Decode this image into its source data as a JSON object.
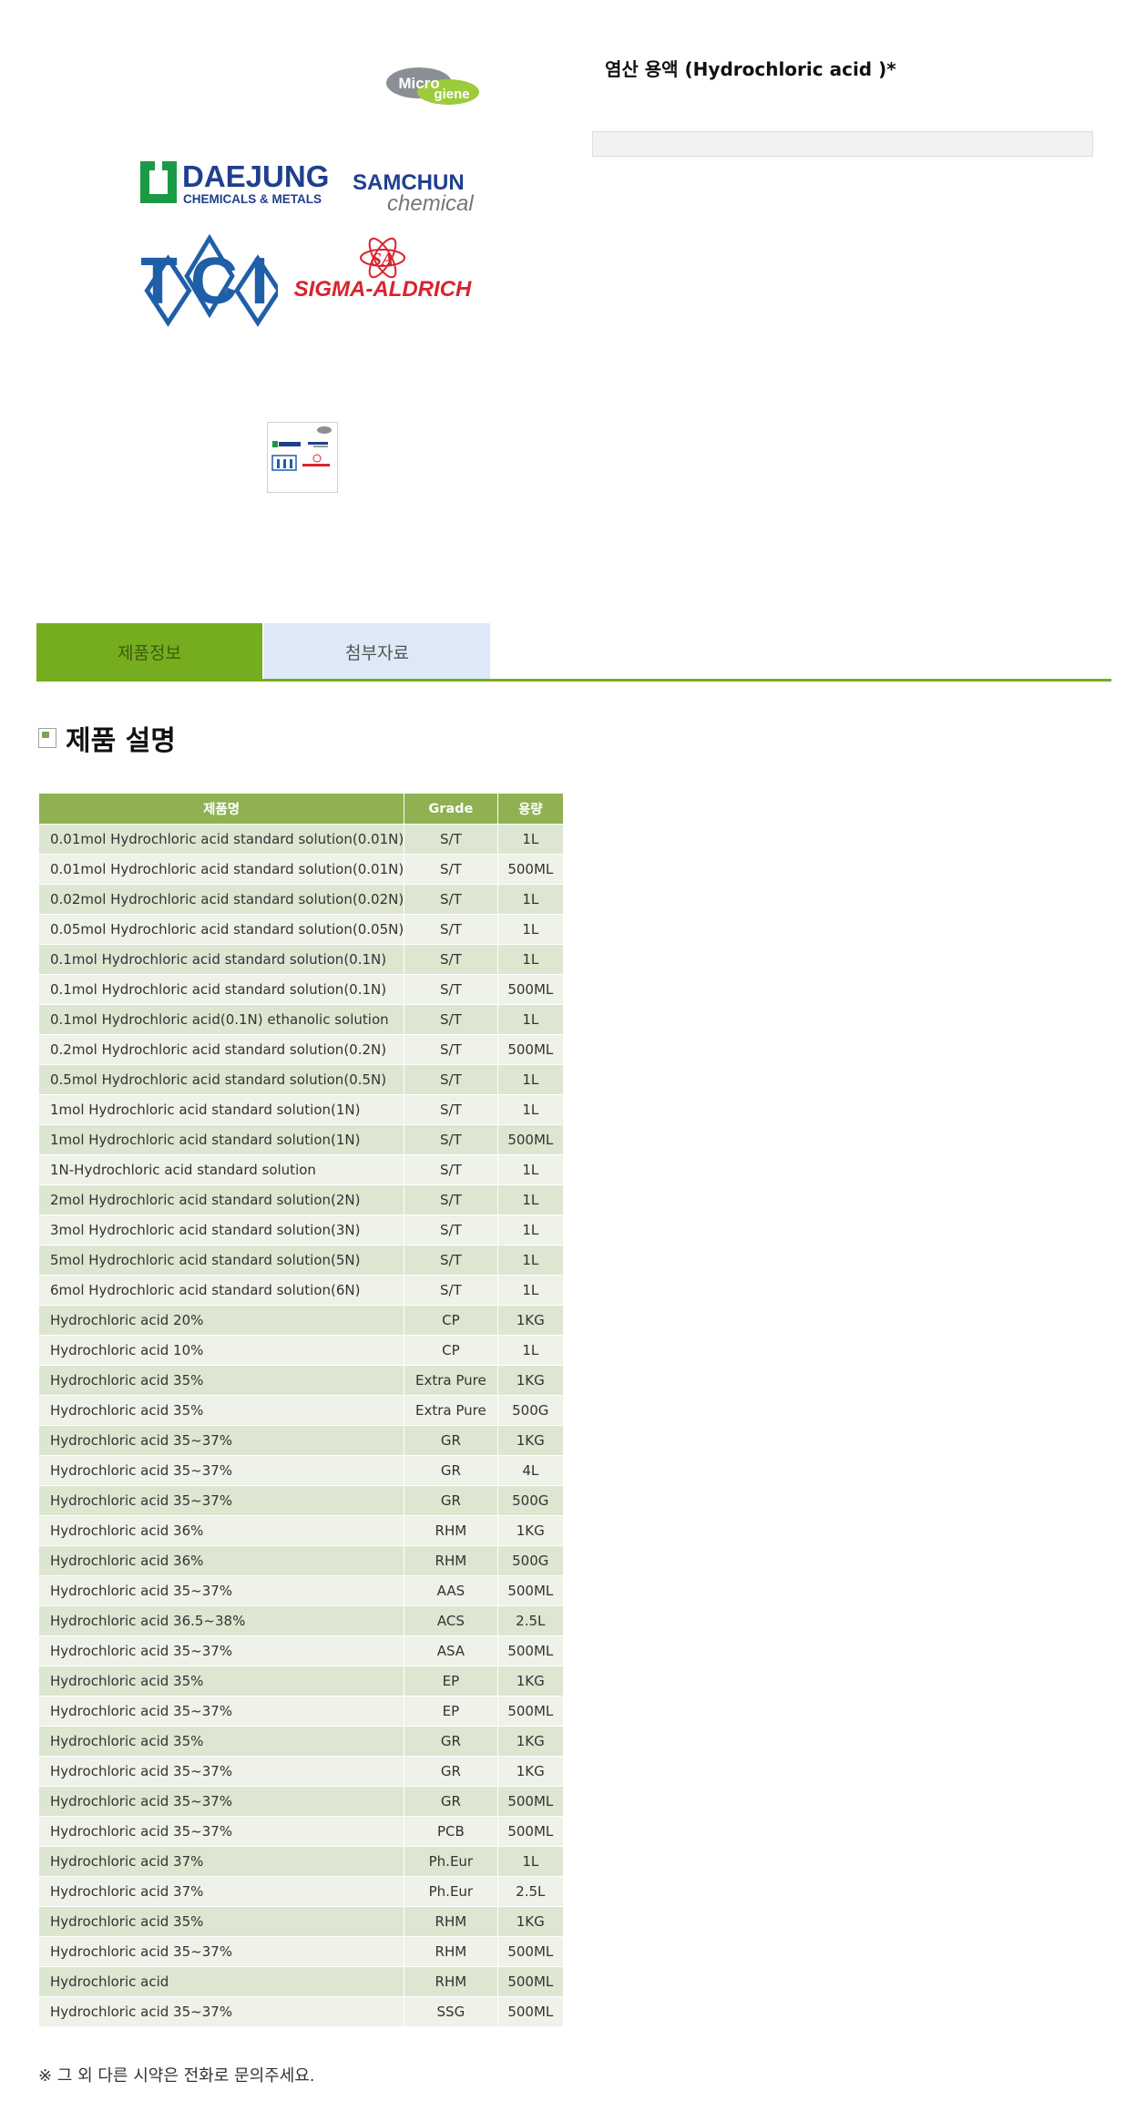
{
  "logos": {
    "microgiene": {
      "line1": "Micro",
      "line2": "giene"
    },
    "daejung": {
      "name": "DAEJUNG",
      "sub": "CHEMICALS & METALS"
    },
    "samchun": {
      "name": "SAMCHUN",
      "sub": "chemical"
    },
    "tci": {
      "name": "TCI"
    },
    "sigma": {
      "name": "SIGMA-ALDRICH",
      "mark": "SA"
    }
  },
  "product": {
    "title": "염산 용액 (Hydrochloric acid )*"
  },
  "tabs": [
    {
      "label": "제품정보",
      "active": true
    },
    {
      "label": "첨부자료",
      "active": false
    }
  ],
  "section": {
    "title": "제품 설명"
  },
  "table": {
    "headers": [
      "제품명",
      "Grade",
      "용량"
    ],
    "rows": [
      [
        "0.01mol Hydrochloric acid standard solution(0.01N)",
        "S/T",
        "1L"
      ],
      [
        "0.01mol Hydrochloric acid standard solution(0.01N)",
        "S/T",
        "500ML"
      ],
      [
        "0.02mol Hydrochloric acid standard solution(0.02N)",
        "S/T",
        "1L"
      ],
      [
        "0.05mol Hydrochloric acid standard solution(0.05N)",
        "S/T",
        "1L"
      ],
      [
        "0.1mol Hydrochloric acid standard solution(0.1N)",
        "S/T",
        "1L"
      ],
      [
        "0.1mol Hydrochloric acid standard solution(0.1N)",
        "S/T",
        "500ML"
      ],
      [
        "0.1mol Hydrochloric acid(0.1N) ethanolic solution",
        "S/T",
        "1L"
      ],
      [
        "0.2mol Hydrochloric acid standard solution(0.2N)",
        "S/T",
        "500ML"
      ],
      [
        "0.5mol Hydrochloric acid standard solution(0.5N)",
        "S/T",
        "1L"
      ],
      [
        "1mol Hydrochloric acid standard solution(1N)",
        "S/T",
        "1L"
      ],
      [
        "1mol Hydrochloric acid standard solution(1N)",
        "S/T",
        "500ML"
      ],
      [
        "1N-Hydrochloric acid standard solution",
        "S/T",
        "1L"
      ],
      [
        "2mol Hydrochloric acid standard solution(2N)",
        "S/T",
        "1L"
      ],
      [
        "3mol Hydrochloric acid standard solution(3N)",
        "S/T",
        "1L"
      ],
      [
        "5mol Hydrochloric acid standard solution(5N)",
        "S/T",
        "1L"
      ],
      [
        "6mol Hydrochloric acid standard solution(6N)",
        "S/T",
        "1L"
      ],
      [
        "Hydrochloric acid 20%",
        "CP",
        "1KG"
      ],
      [
        "Hydrochloric acid 10%",
        "CP",
        "1L"
      ],
      [
        "Hydrochloric acid 35%",
        "Extra Pure",
        "1KG"
      ],
      [
        "Hydrochloric acid 35%",
        "Extra Pure",
        "500G"
      ],
      [
        "Hydrochloric acid 35~37%",
        "GR",
        "1KG"
      ],
      [
        "Hydrochloric acid 35~37%",
        "GR",
        "4L"
      ],
      [
        "Hydrochloric acid 35~37%",
        "GR",
        "500G"
      ],
      [
        "Hydrochloric acid 36%",
        "RHM",
        "1KG"
      ],
      [
        "Hydrochloric acid 36%",
        "RHM",
        "500G"
      ],
      [
        "Hydrochloric acid 35~37%",
        "AAS",
        "500ML"
      ],
      [
        "Hydrochloric acid 36.5~38%",
        "ACS",
        "2.5L"
      ],
      [
        "Hydrochloric acid 35~37%",
        "ASA",
        "500ML"
      ],
      [
        "Hydrochloric acid 35%",
        "EP",
        "1KG"
      ],
      [
        "Hydrochloric acid 35~37%",
        "EP",
        "500ML"
      ],
      [
        "Hydrochloric acid 35%",
        "GR",
        "1KG"
      ],
      [
        "Hydrochloric acid 35~37%",
        "GR",
        "1KG"
      ],
      [
        "Hydrochloric acid 35~37%",
        "GR",
        "500ML"
      ],
      [
        "Hydrochloric acid 35~37%",
        "PCB",
        "500ML"
      ],
      [
        "Hydrochloric acid 37%",
        "Ph.Eur",
        "1L"
      ],
      [
        "Hydrochloric acid 37%",
        "Ph.Eur",
        "2.5L"
      ],
      [
        "Hydrochloric acid 35%",
        "RHM",
        "1KG"
      ],
      [
        "Hydrochloric acid 35~37%",
        "RHM",
        "500ML"
      ],
      [
        "Hydrochloric acid",
        "RHM",
        "500ML"
      ],
      [
        "Hydrochloric acid 35~37%",
        "SSG",
        "500ML"
      ]
    ]
  },
  "footer": {
    "note": "※ 그 외 다른 시약은 전화로 문의주세요."
  },
  "colors": {
    "tab_active": "#76ad1e",
    "tab_inactive": "#dde9f6",
    "table_header": "#8fb152",
    "row_odd": "#dde6d0",
    "row_even": "#eef2e8"
  }
}
